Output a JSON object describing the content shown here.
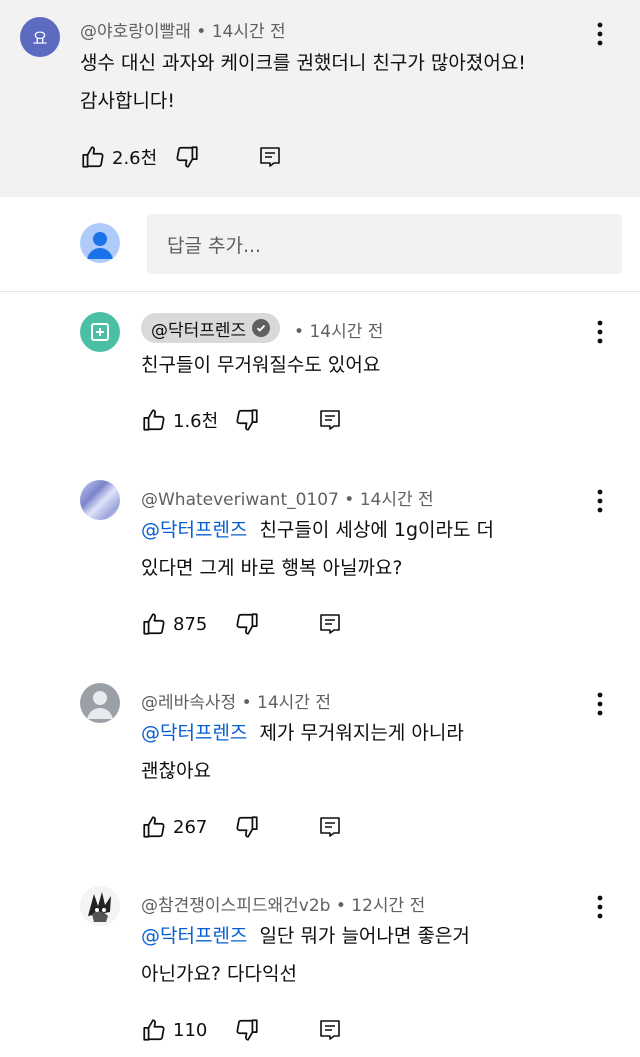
{
  "parent_comment": {
    "avatar_letter": "요",
    "avatar_color": "#5c6bc0",
    "author": "@야호랑이빨래",
    "time": "14시간 전",
    "text_line1": "생수 대신 과자와 케이크를 권했더니 친구가 많아졌어요!",
    "text_line2": "감사합니다!",
    "likes": "2.6천"
  },
  "reply_input": {
    "placeholder": "답글 추가..."
  },
  "replies": [
    {
      "author": "@닥터프렌즈",
      "verified": true,
      "time": "14시간 전",
      "text_line1": "친구들이 무거워질수도 있어요",
      "likes": "1.6천",
      "avatar_color": "#34a893"
    },
    {
      "author": "@Whateveriwant_0107",
      "time": "14시간 전",
      "mention": "@닥터프렌즈",
      "text_line1": "친구들이 세상에 1g이라도 더",
      "text_line2": "있다면 그게 바로 행복 아닐까요?",
      "likes": "875"
    },
    {
      "author": "@레바속사정",
      "time": "14시간 전",
      "mention": "@닥터프렌즈",
      "text_line1": "제가 무거워지는게 아니라",
      "text_line2": "괜찮아요",
      "likes": "267"
    },
    {
      "author": "@참견쟁이스피드왜건v2b",
      "time": "12시간 전",
      "mention": "@닥터프렌즈",
      "text_line1": "일단 뭐가 늘어나면 좋은거",
      "text_line2": "아닌가요? 다다익선",
      "likes": "110"
    }
  ],
  "separator": "•",
  "accent_color": "#065fd4"
}
